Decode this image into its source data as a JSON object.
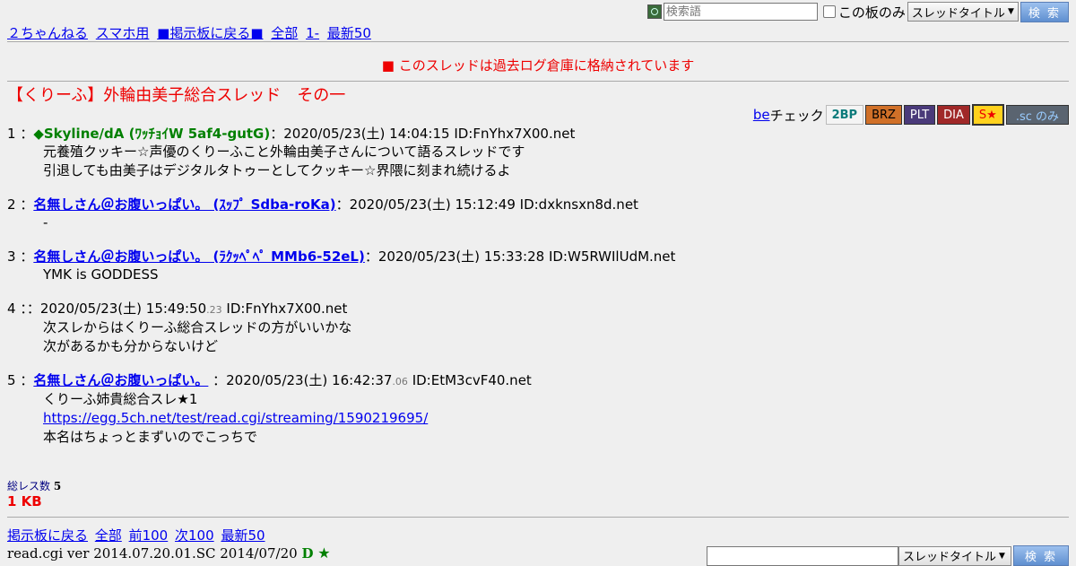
{
  "search": {
    "placeholder": "検索語",
    "board_only": "この板のみ",
    "scope": "スレッドタイトル",
    "button": "検 索"
  },
  "nav_top": [
    "２ちゃんねる",
    "スマホ用",
    "■掲示板に戻る■",
    "全部",
    "1-",
    "最新50"
  ],
  "notice": "■ このスレッドは過去ログ倉庫に格納されています",
  "thread_title": "【くりーふ】外輪由美子総合スレッド　その一",
  "be_check": {
    "be": "be",
    "check": "チェック",
    "badges": [
      "2BP",
      "BRZ",
      "PLT",
      "DIA",
      "S★",
      ".sc のみ"
    ]
  },
  "posts": [
    {
      "num": "1",
      "name": "◆Skyline/dA (ﾜｯﾁｮｲW 5af4-gutG)",
      "name_style": "green",
      "date": "2020/05/23(土) 14:04:15",
      "msec": "",
      "id": "ID:FnYhx7X00.net",
      "lines": [
        "元養殖クッキー☆声優のくりーふこと外輪由美子さんについて語るスレッドです",
        "引退しても由美子はデジタルタトゥーとしてクッキー☆界隈に刻まれ続けるよ"
      ]
    },
    {
      "num": "2",
      "name": "名無しさん＠お腹いっぱい。 (ｽｯﾌﾟ Sdba-roKa)",
      "name_style": "link",
      "date": "2020/05/23(土) 15:12:49",
      "msec": "",
      "id": "ID:dxknsxn8d.net",
      "lines": [
        "-"
      ]
    },
    {
      "num": "3",
      "name": "名無しさん＠お腹いっぱい。 (ﾗｸｯﾍﾟﾍﾟ MMb6-52eL)",
      "name_style": "link",
      "date": "2020/05/23(土) 15:33:28",
      "msec": "",
      "id": "ID:W5RWIlUdM.net",
      "lines": [
        "YMK is GODDESS"
      ]
    },
    {
      "num": "4",
      "name": "",
      "name_style": "none",
      "date": "2020/05/23(土) 15:49:50",
      "msec": ".23",
      "id": "ID:FnYhx7X00.net",
      "lines": [
        "次スレからはくりーふ総合スレッドの方がいいかな",
        "次があるかも分からないけど"
      ]
    },
    {
      "num": "5",
      "name": "名無しさん＠お腹いっぱい。",
      "name_style": "link",
      "date": "2020/05/23(土) 16:42:37",
      "msec": ".06",
      "id": "ID:EtM3cvF40.net",
      "lines": [
        "くりーふ姉貴総合スレ★1"
      ],
      "link": "https://egg.5ch.net/test/read.cgi/streaming/1590219695/",
      "after": [
        "本名はちょっとまずいのでこっちで"
      ]
    }
  ],
  "total_label": "総レス数",
  "total_count": "5",
  "size": "1 KB",
  "nav_bottom": [
    "掲示板に戻る",
    "全部",
    "前100",
    "次100",
    "最新50"
  ],
  "version": {
    "text": "read.cgi ver 2014.07.20.01.SC 2014/07/20",
    "d": "D",
    "star": "★"
  }
}
